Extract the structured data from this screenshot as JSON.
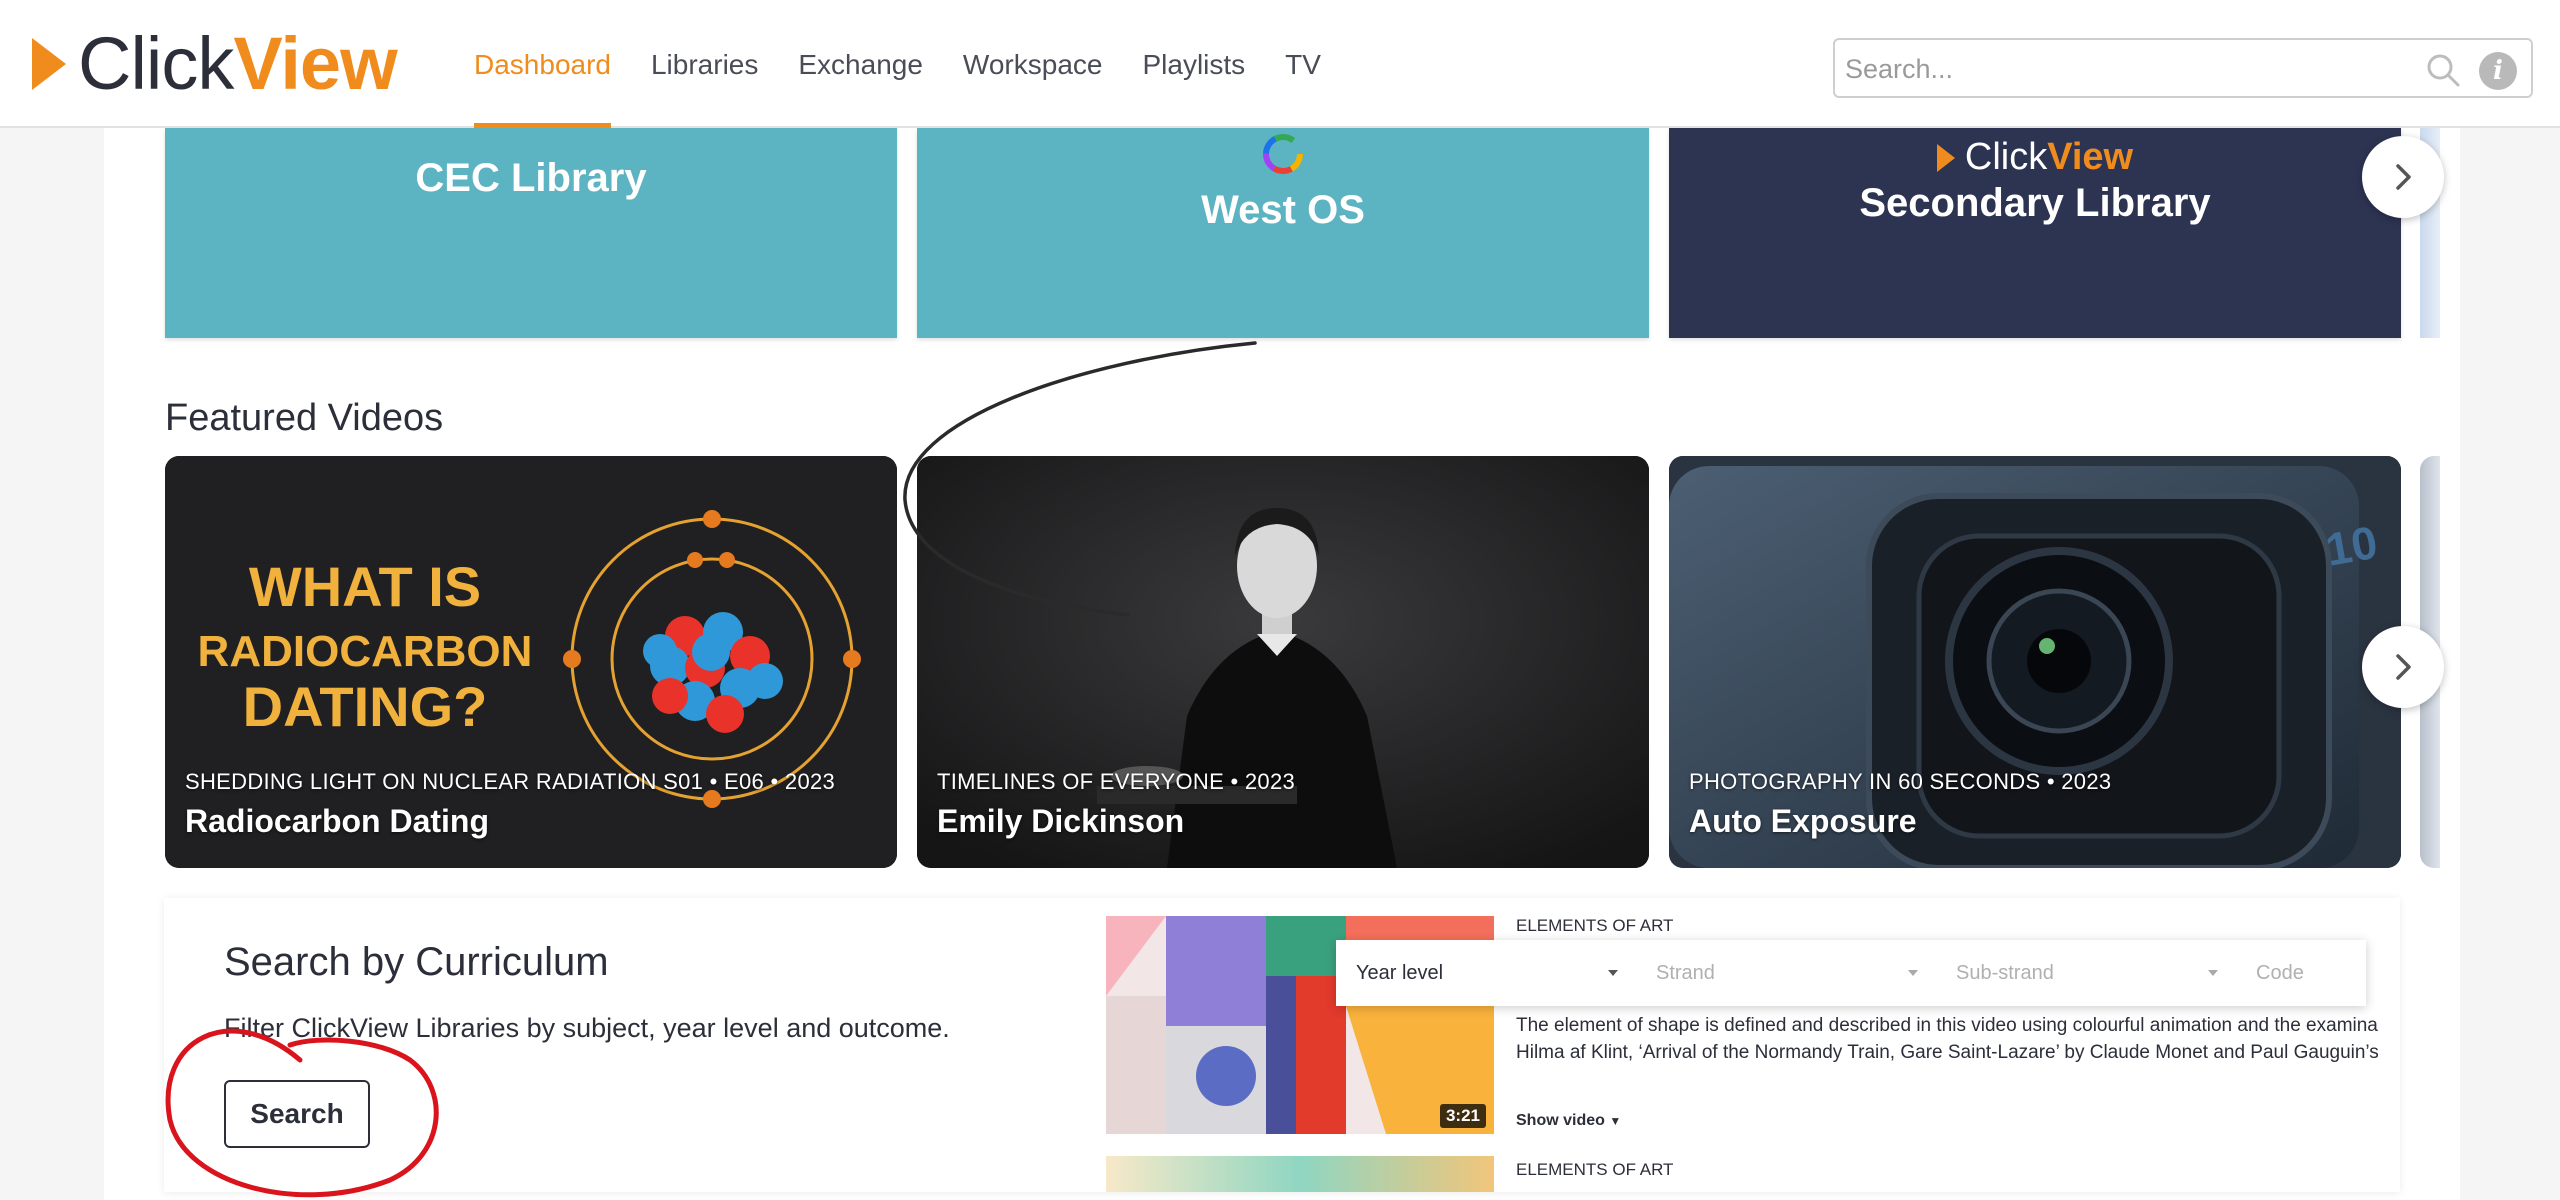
{
  "header": {
    "logo": {
      "part1": "Click",
      "part2": "View"
    },
    "nav": [
      {
        "label": "Dashboard",
        "active": true
      },
      {
        "label": "Libraries"
      },
      {
        "label": "Exchange"
      },
      {
        "label": "Workspace"
      },
      {
        "label": "Playlists"
      },
      {
        "label": "TV"
      }
    ],
    "search": {
      "placeholder": "Search..."
    },
    "info_label": "i"
  },
  "libraries": [
    {
      "title": "CEC Library",
      "color": "#5cb3c1"
    },
    {
      "title": "West OS",
      "color": "#5cb3c1"
    },
    {
      "title": "Secondary Library",
      "brand_part1": "Click",
      "brand_part2": "View",
      "color": "#2d3452"
    }
  ],
  "featured": {
    "title": "Featured Videos",
    "videos": [
      {
        "series": "SHEDDING LIGHT ON NUCLEAR RADIATION S01 • E06 • 2023",
        "title": "Radiocarbon Dating",
        "thumb_lines": [
          "WHAT IS",
          "RADIOCARBON",
          "DATING?"
        ]
      },
      {
        "series": "TIMELINES OF EVERYONE • 2023",
        "title": "Emily Dickinson"
      },
      {
        "series": "PHOTOGRAPHY IN 60 SECONDS • 2023",
        "title": "Auto Exposure",
        "camera_badge": "10"
      }
    ]
  },
  "curriculum": {
    "title": "Search by Curriculum",
    "description": "Filter ClickView Libraries by subject, year level and outcome.",
    "button_label": "Search",
    "preview": {
      "filters": [
        "Year level",
        "Strand",
        "Sub-strand",
        "Code"
      ],
      "label": "ELEMENTS OF ART",
      "duration": "3:21",
      "description_lines": [
        "The element of shape is defined and described in this video using colourful animation and the examina",
        "Hilma af Klint, ‘Arrival of the Normandy Train, Gare Saint-Lazare’ by Claude Monet and Paul Gauguin’s"
      ],
      "show_video": "Show video",
      "label_2": "ELEMENTS OF ART"
    }
  },
  "colors": {
    "brand_orange": "#f08c1e",
    "teal": "#5cb3c1",
    "navy": "#2d3452",
    "annotation_red": "#d9141c"
  }
}
